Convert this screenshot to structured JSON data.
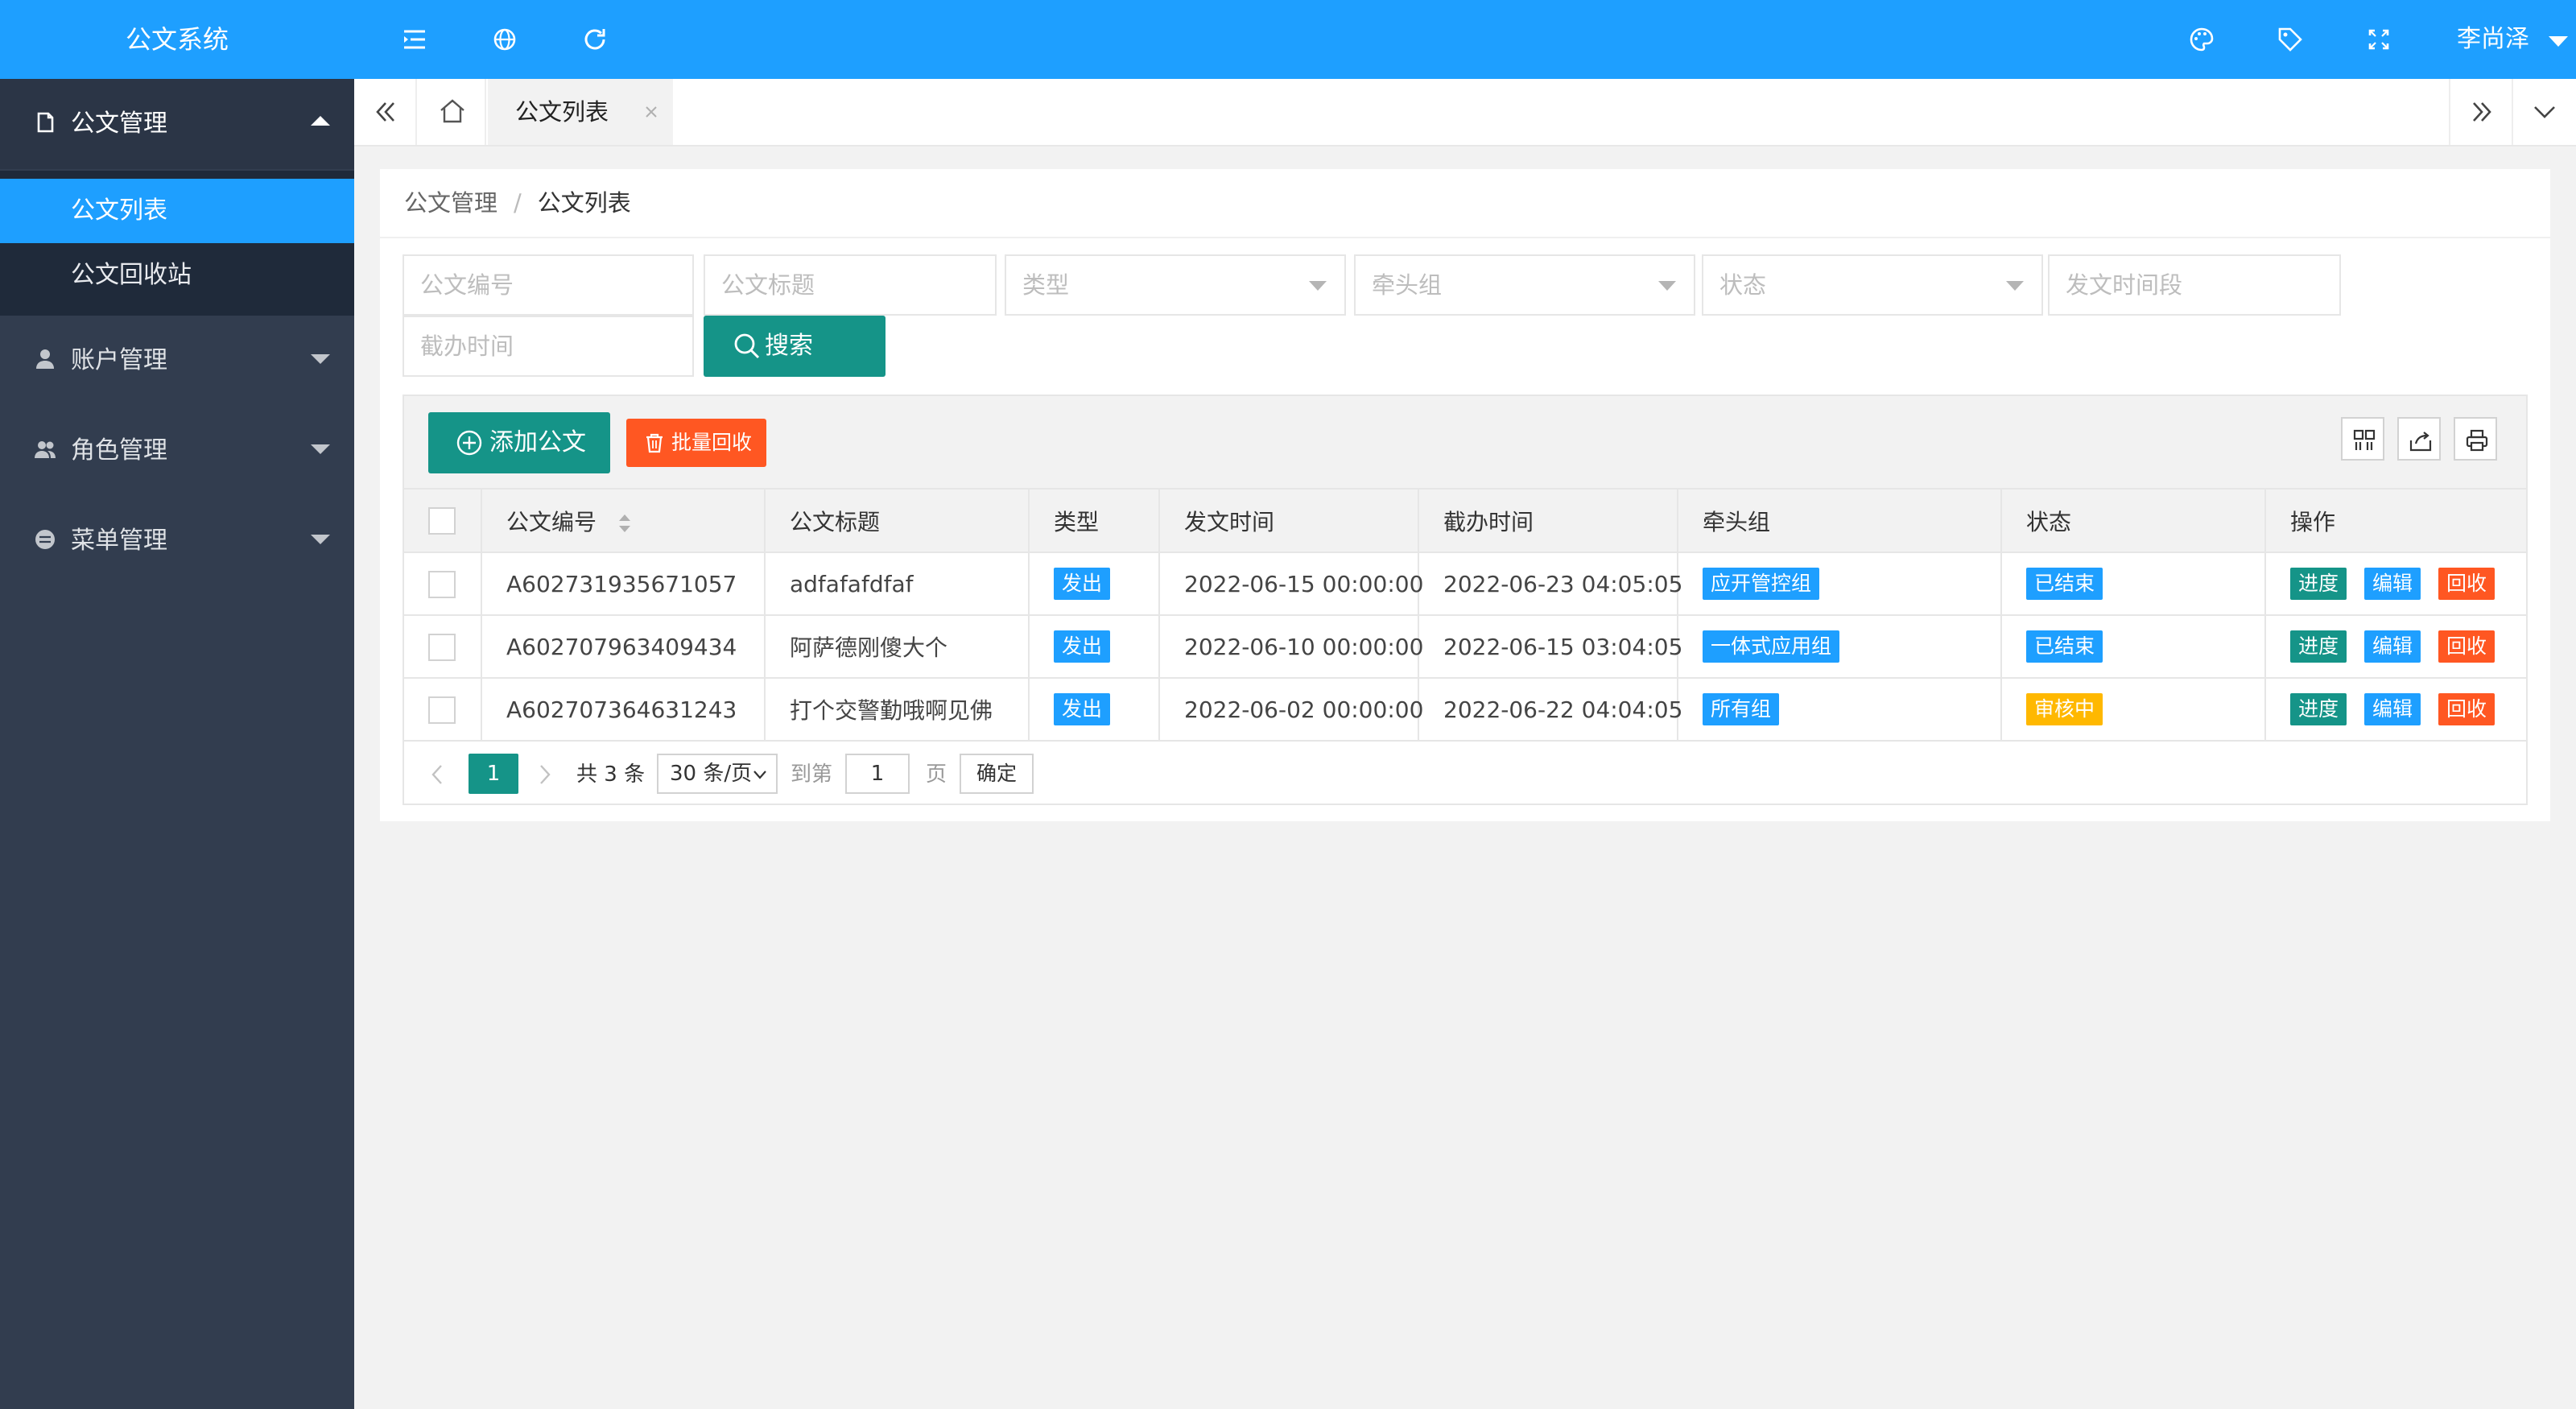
{
  "app": {
    "title": "公文系统",
    "user": "李尚泽"
  },
  "sidebar": {
    "groups": [
      {
        "label": "公文管理",
        "icon": "document-icon"
      },
      {
        "label": "账户管理",
        "icon": "user-icon"
      },
      {
        "label": "角色管理",
        "icon": "users-icon"
      },
      {
        "label": "菜单管理",
        "icon": "menu-icon"
      }
    ],
    "sub_items": [
      {
        "label": "公文列表"
      },
      {
        "label": "公文回收站"
      }
    ]
  },
  "tabs": {
    "active": "公文列表"
  },
  "breadcrumb": {
    "parent": "公文管理",
    "separator": "/",
    "current": "公文列表"
  },
  "filters": {
    "doc_no": "公文编号",
    "doc_title": "公文标题",
    "type": "类型",
    "group": "牵头组",
    "status": "状态",
    "send_period": "发文时间段",
    "deadline": "截办时间",
    "search_label": "搜索"
  },
  "toolbar": {
    "add_label": "添加公文",
    "batch_label": "批量回收"
  },
  "table": {
    "columns": [
      "公文编号",
      "公文标题",
      "类型",
      "发文时间",
      "截办时间",
      "牵头组",
      "状态",
      "操作"
    ],
    "rows": [
      {
        "no": "A602731935671057",
        "title": "adfafafdfaf",
        "type": "发出",
        "send_time": "2022-06-15 00:00:00",
        "deadline": "2022-06-23 04:05:05",
        "group": "应开管控组",
        "status": "已结束"
      },
      {
        "no": "A602707963409434",
        "title": "阿萨德刚傻大个",
        "type": "发出",
        "send_time": "2022-06-10 00:00:00",
        "deadline": "2022-06-15 03:04:05",
        "group": "一体式应用组",
        "status": "已结束"
      },
      {
        "no": "A602707364631243",
        "title": "打个交警勤哦啊见佛",
        "type": "发出",
        "send_time": "2022-06-02 00:00:00",
        "deadline": "2022-06-22 04:04:05",
        "group": "所有组",
        "status": "审核中"
      }
    ],
    "actions": {
      "progress": "进度",
      "edit": "编辑",
      "recycle": "回收"
    }
  },
  "pager": {
    "current": "1",
    "total": "共 3 条",
    "page_size": "30 条/页",
    "goto_label": "到第",
    "goto_value": "1",
    "page_suffix": "页",
    "confirm": "确定"
  },
  "colors": {
    "brand_blue": "#1e9fff",
    "sidebar": "#323d4f",
    "green": "#159488",
    "red": "#ff5722",
    "orange": "#ffb800"
  }
}
